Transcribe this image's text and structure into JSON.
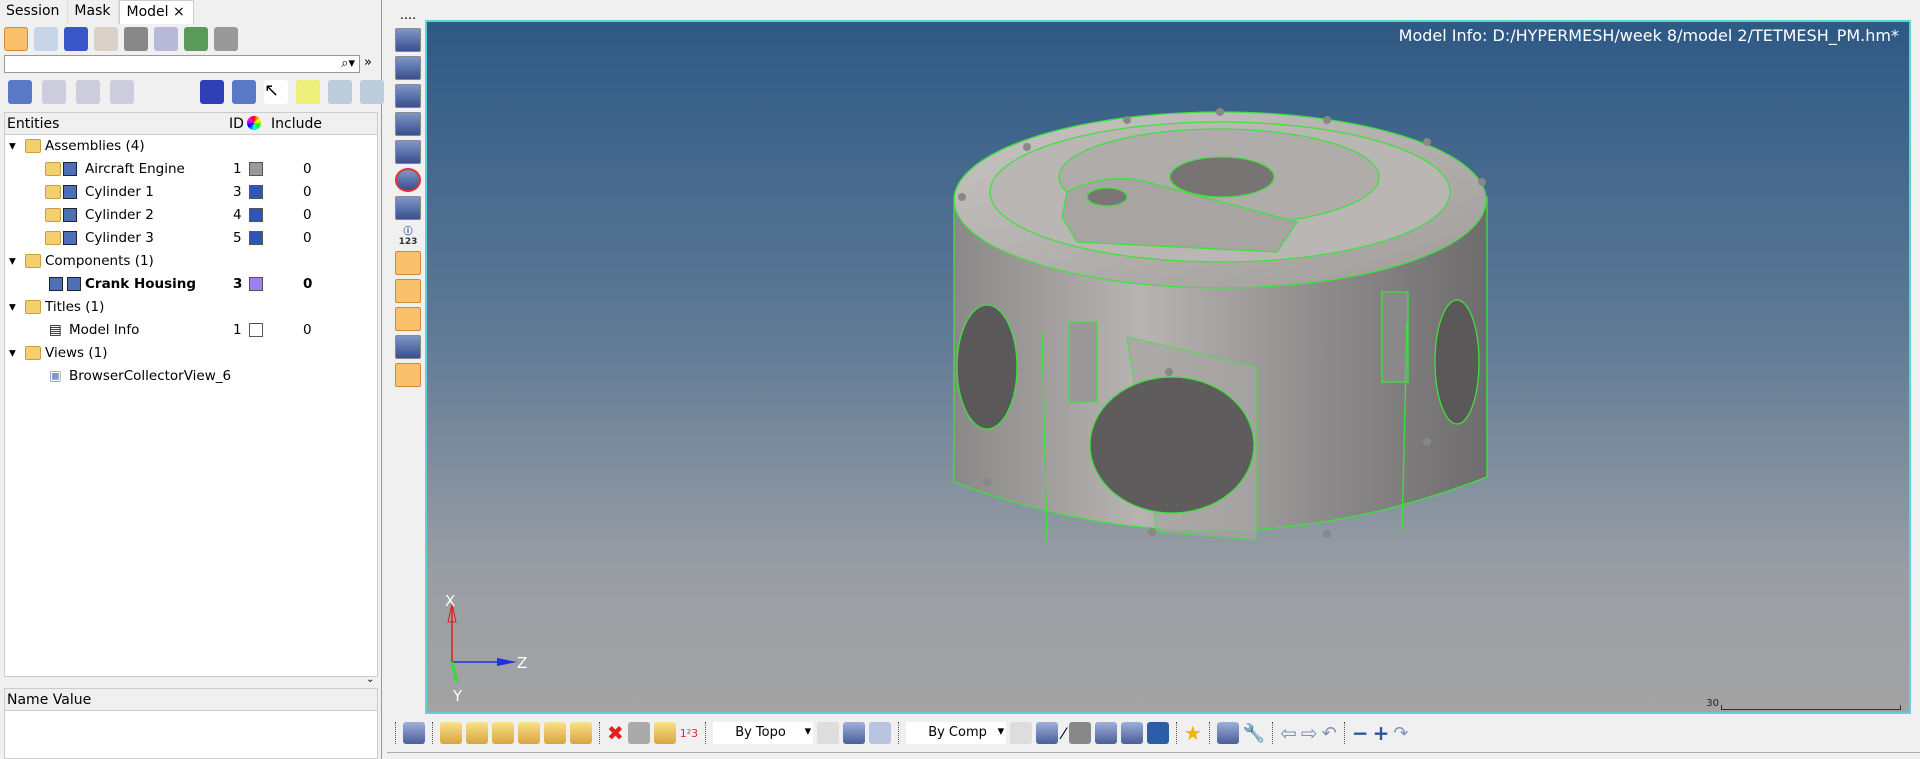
{
  "tabs": [
    {
      "label": "Session"
    },
    {
      "label": "Mask"
    },
    {
      "label": "Model",
      "close": "×"
    }
  ],
  "search": {
    "placeholder": ""
  },
  "tree": {
    "columns": {
      "entities": "Entities",
      "id": "ID",
      "include": "Include"
    },
    "groups": [
      {
        "label": "Assemblies (4)",
        "items": [
          {
            "name": "Aircraft Engine",
            "id": "1",
            "color": "#9a9a9a",
            "include": "0"
          },
          {
            "name": "Cylinder 1",
            "id": "3",
            "color": "#2e55b8",
            "include": "0"
          },
          {
            "name": "Cylinder 2",
            "id": "4",
            "color": "#2e55b8",
            "include": "0"
          },
          {
            "name": "Cylinder 3",
            "id": "5",
            "color": "#2e55b8",
            "include": "0"
          }
        ]
      },
      {
        "label": "Components (1)",
        "items": [
          {
            "name": "Crank Housing",
            "id": "3",
            "color": "#a080f0",
            "include": "0"
          }
        ]
      },
      {
        "label": "Titles (1)",
        "items": [
          {
            "name": "Model Info",
            "id": "1",
            "color": "#ffffff",
            "include": "0"
          }
        ]
      },
      {
        "label": "Views (1)",
        "items": [
          {
            "name": "BrowserCollectorView_6"
          }
        ]
      }
    ]
  },
  "props": {
    "header": "Name Value"
  },
  "viewport": {
    "model_info": "Model Info: D:/HYPERMESH/week 8/model 2/TETMESH_PM.hm*",
    "axis": {
      "x": "X",
      "y": "Y",
      "z": "Z"
    },
    "scale": "30"
  },
  "toolbar": {
    "by_topo": "By Topo",
    "by_comp": "By Comp"
  },
  "vtoolbar": {
    "info_label": "123"
  }
}
